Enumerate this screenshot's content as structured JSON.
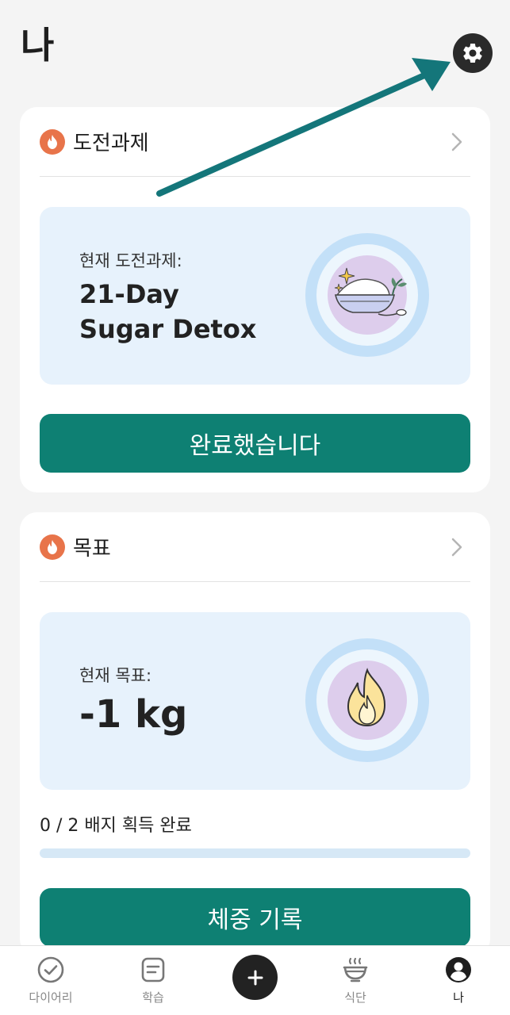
{
  "header": {
    "title": "나",
    "settings_icon": "gear-icon"
  },
  "challenge_card": {
    "title": "도전과제",
    "current_label": "현재 도전과제:",
    "current_value": "21-Day Sugar Detox",
    "button_label": "완료했습니다",
    "illustration": "rice-bowl-sparkle-illustration"
  },
  "goal_card": {
    "title": "목표",
    "current_label": "현재 목표:",
    "current_value": "-1 kg",
    "progress_text": "0 / 2 배지 획득 완료",
    "badges_earned": 0,
    "badges_total": 2,
    "button_label": "체중 기록",
    "illustration": "flame-illustration"
  },
  "bottom_nav": {
    "items": [
      {
        "label": "다이어리",
        "icon": "check-circle-icon"
      },
      {
        "label": "학습",
        "icon": "notes-icon"
      },
      {
        "label": "",
        "icon": "plus-icon"
      },
      {
        "label": "식단",
        "icon": "bowl-steam-icon"
      },
      {
        "label": "나",
        "icon": "profile-icon"
      }
    ],
    "active_index": 4
  },
  "colors": {
    "accent": "#0e8073",
    "fire": "#e8744a",
    "info_bg": "#e7f2fc",
    "page_bg": "#f4f4f4",
    "annotation_arrow": "#14767a"
  }
}
